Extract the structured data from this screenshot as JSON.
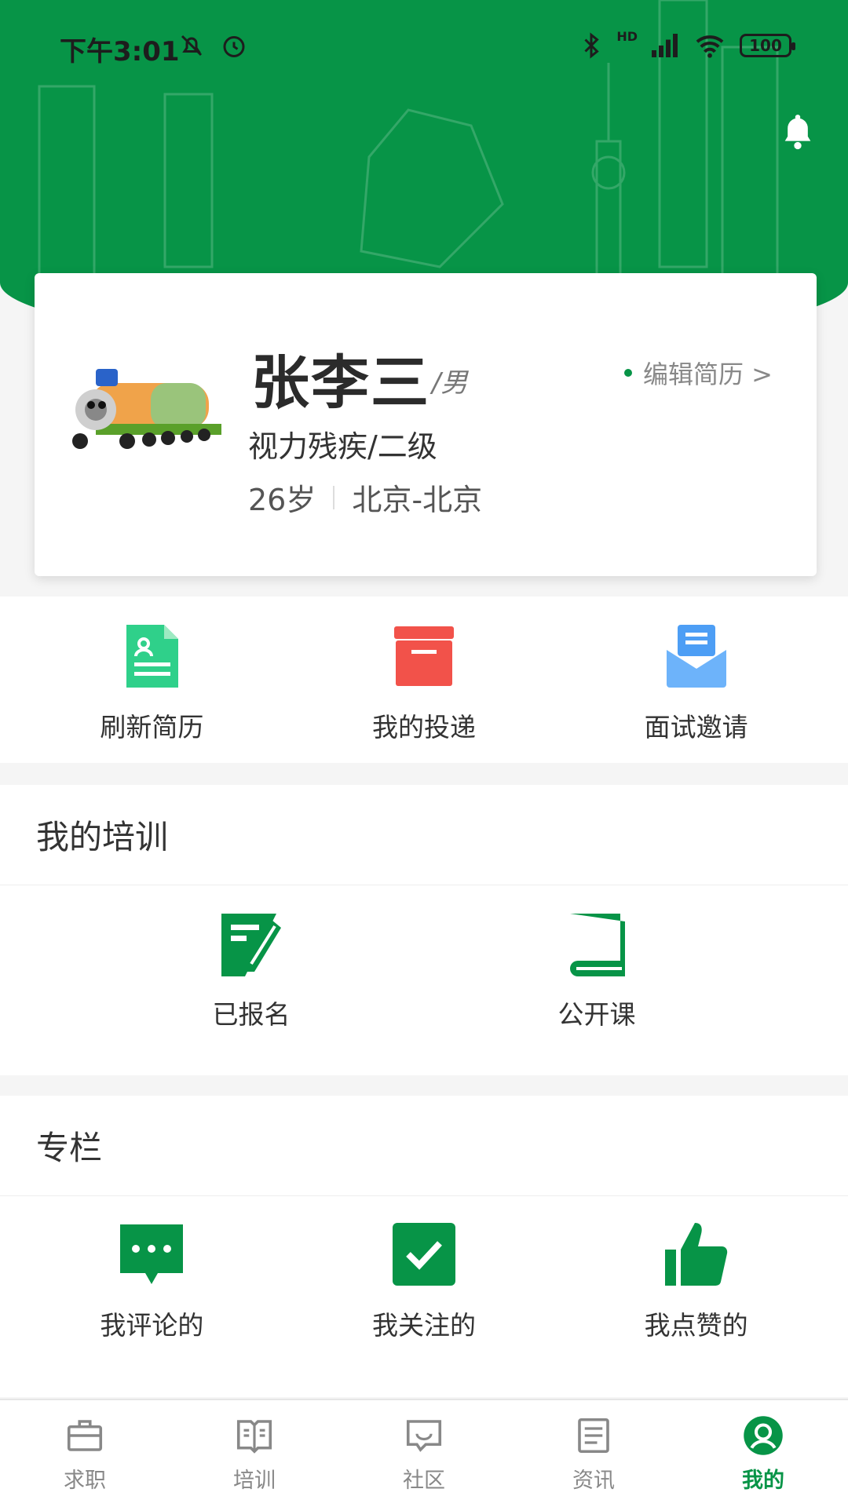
{
  "status_bar": {
    "time": "下午3:01",
    "battery": "100",
    "network": "HD"
  },
  "profile": {
    "name": "张李三",
    "gender": "/男",
    "edit_label": "编辑简历 >",
    "disability": "视力残疾/二级",
    "age": "26岁",
    "location": "北京-北京"
  },
  "quick_actions": [
    {
      "label": "刷新简历",
      "icon": "resume-icon"
    },
    {
      "label": "我的投递",
      "icon": "box-icon"
    },
    {
      "label": "面试邀请",
      "icon": "mail-icon"
    }
  ],
  "training": {
    "title": "我的培训",
    "items": [
      {
        "label": "已报名",
        "icon": "signup-icon"
      },
      {
        "label": "公开课",
        "icon": "book-icon"
      }
    ]
  },
  "column": {
    "title": "专栏",
    "items": [
      {
        "label": "我评论的",
        "icon": "comment-icon"
      },
      {
        "label": "我关注的",
        "icon": "check-icon"
      },
      {
        "label": "我点赞的",
        "icon": "thumbs-up-icon"
      }
    ]
  },
  "tabs": [
    {
      "label": "求职",
      "icon": "briefcase-icon"
    },
    {
      "label": "培训",
      "icon": "book-open-icon"
    },
    {
      "label": "社区",
      "icon": "chat-icon"
    },
    {
      "label": "资讯",
      "icon": "news-icon"
    },
    {
      "label": "我的",
      "icon": "user-icon",
      "active": true
    }
  ],
  "colors": {
    "brand": "#079447",
    "resume": "#2fd08a",
    "box": "#f2524a",
    "mail": "#4d9ef5",
    "card_bg": "#ffffff"
  }
}
